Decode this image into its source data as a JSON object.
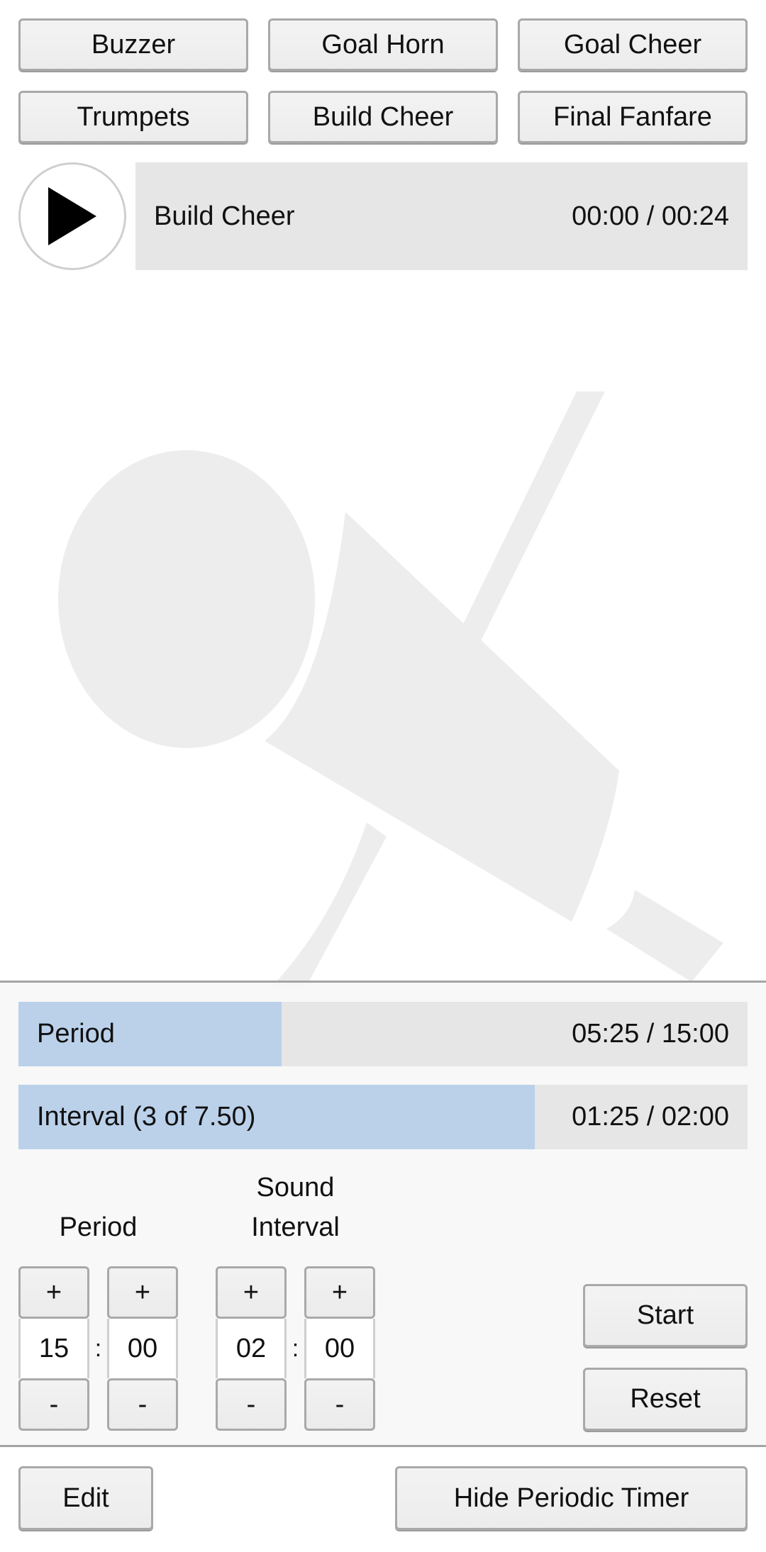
{
  "sound_buttons": [
    {
      "label": "Buzzer"
    },
    {
      "label": "Goal Horn"
    },
    {
      "label": "Goal Cheer"
    },
    {
      "label": "Trumpets"
    },
    {
      "label": "Build Cheer"
    },
    {
      "label": "Final Fanfare"
    }
  ],
  "player": {
    "icon": "play-icon",
    "track_name": "Build Cheer",
    "time": "00:00 / 00:24"
  },
  "background_icon": "microphone-icon",
  "timer": {
    "period_bar": {
      "label": "Period",
      "time": "05:25 / 15:00",
      "progress": 0.361
    },
    "interval_bar": {
      "label": "Interval (3 of 7.50)",
      "time": "01:25 / 02:00",
      "progress": 0.708
    },
    "period_label": "Period",
    "interval_label_line1": "Sound",
    "interval_label_line2": "Interval",
    "plus_label": "+",
    "minus_label": "-",
    "separator": ":",
    "period_minutes": "15",
    "period_seconds": "00",
    "interval_minutes": "02",
    "interval_seconds": "00",
    "start_label": "Start",
    "reset_label": "Reset",
    "colors": {
      "progress_fill": "#b8d0ea",
      "progress_track": "#e4e4e4"
    }
  },
  "footer": {
    "edit_label": "Edit",
    "hide_timer_label": "Hide Periodic Timer"
  }
}
